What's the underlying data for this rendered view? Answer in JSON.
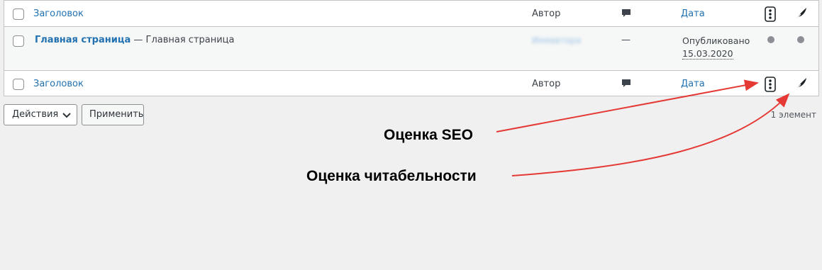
{
  "table": {
    "header": {
      "title": "Заголовок",
      "author": "Автор",
      "date": "Дата"
    },
    "rows": [
      {
        "title_link": "Главная страница",
        "title_rest": " — Главная страница",
        "author": "Имяавтора",
        "comments": "—",
        "date_status": "Опубликовано",
        "date_value": "15.03.2020"
      }
    ],
    "footer": {
      "title": "Заголовок",
      "author": "Автор",
      "date": "Дата"
    }
  },
  "bulk_actions": {
    "select_value": "Действия",
    "apply_label": "Применить"
  },
  "item_count": "1 элемент",
  "annotations": {
    "seo_label": "Оценка SEO",
    "readability_label": "Оценка читабельности",
    "arrow_color": "#e53935"
  },
  "colors": {
    "link": "#2271b1",
    "score_dot": "#8c8f94"
  }
}
